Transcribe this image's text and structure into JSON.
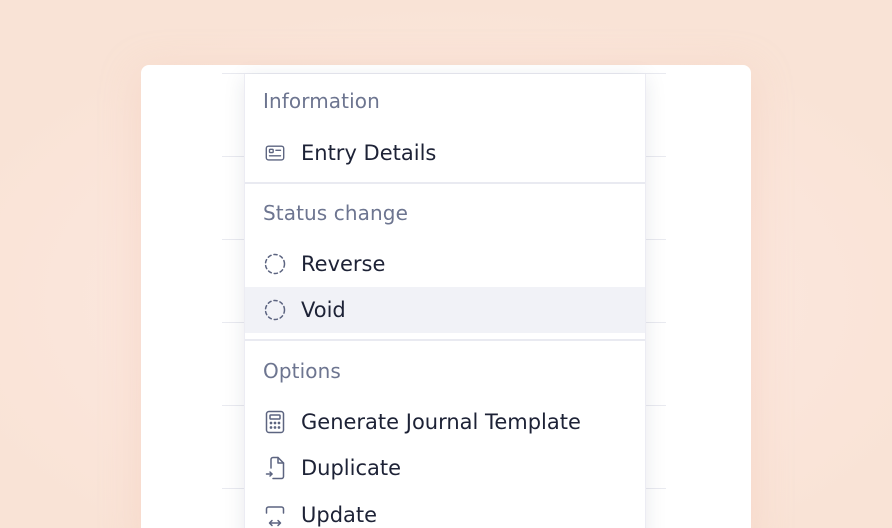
{
  "menu": {
    "sections": [
      {
        "header": "Information",
        "items": [
          {
            "label": "Entry Details",
            "icon": "id-card-icon",
            "highlighted": false
          }
        ]
      },
      {
        "header": "Status change",
        "items": [
          {
            "label": "Reverse",
            "icon": "dashed-circle-icon",
            "highlighted": false
          },
          {
            "label": "Void",
            "icon": "dashed-circle-icon",
            "highlighted": true
          }
        ]
      },
      {
        "header": "Options",
        "items": [
          {
            "label": "Generate Journal Template",
            "icon": "calculator-icon",
            "highlighted": false
          },
          {
            "label": "Duplicate",
            "icon": "duplicate-file-icon",
            "highlighted": false
          },
          {
            "label": "Update",
            "icon": "update-arrows-icon",
            "highlighted": false
          }
        ]
      }
    ]
  },
  "colors": {
    "background": "#fae6db",
    "header_text": "#6d7590",
    "item_text": "#1d2236",
    "highlight": "#f1f2f7",
    "icon_stroke": "#5c6480"
  }
}
